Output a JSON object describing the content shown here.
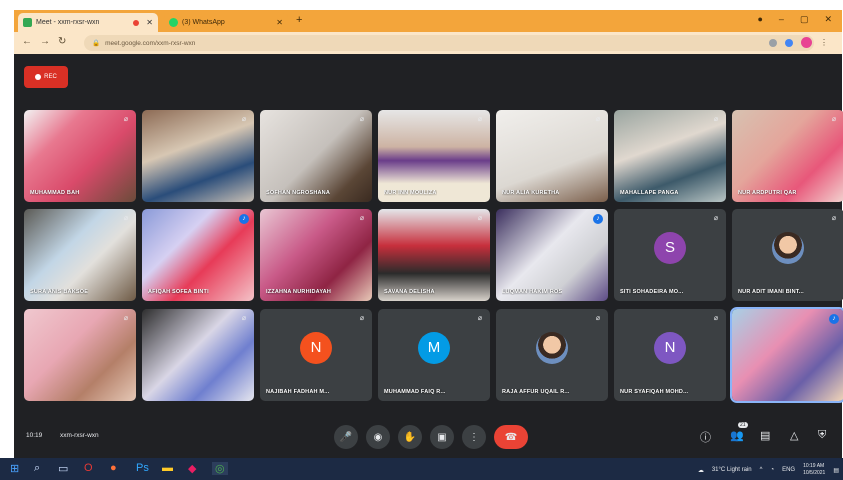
{
  "browser": {
    "tabs": [
      {
        "title": "Meet - xxm-rxsr-wxn",
        "favicon": "meet-icon",
        "active": true
      },
      {
        "title": "(3) WhatsApp",
        "favicon": "whatsapp-icon",
        "active": false
      }
    ],
    "new_tab_label": "+",
    "url": "meet.google.com/xxm-rxsr-wxn",
    "colors": {
      "tabbar": "#f3a53b",
      "toolbar": "#fbe6c8"
    }
  },
  "meet": {
    "record_label": "REC",
    "participants": [
      {
        "name": "MUHAMMAD BAH",
        "type": "video",
        "muted": true
      },
      {
        "name": "",
        "type": "video",
        "muted": true
      },
      {
        "name": "SOFHAN NGROSHANA",
        "type": "video",
        "muted": true
      },
      {
        "name": "NUR INN MOULIZA",
        "type": "video",
        "muted": true
      },
      {
        "name": "NUR ALIA KURETHA",
        "type": "video",
        "muted": true
      },
      {
        "name": "MAHALLAPE PANGA",
        "type": "video",
        "muted": true
      },
      {
        "name": "NUR ARDPUTRI QAR",
        "type": "video",
        "muted": true
      },
      {
        "name": "SURA ANIS BAKSOE",
        "type": "video",
        "muted": true
      },
      {
        "name": "AFIQAH SOFEA BINTI",
        "type": "video",
        "muted": false
      },
      {
        "name": "IZZAHNA NURHIDAYAH",
        "type": "video",
        "muted": true
      },
      {
        "name": "SAVANA DELISHA",
        "type": "video",
        "muted": true
      },
      {
        "name": "LUQMAN HAKIM ROS",
        "type": "video",
        "muted": false
      },
      {
        "name": "SITI SOHADEIRA MO...",
        "type": "avatar",
        "initial": "S",
        "color": "#8e44ad",
        "muted": true
      },
      {
        "name": "NUR ADIT IMANI BINT...",
        "type": "photo",
        "muted": true
      },
      {
        "name": "",
        "type": "video",
        "muted": true
      },
      {
        "name": "",
        "type": "video",
        "muted": true
      },
      {
        "name": "NAJIBAH FADHAH M...",
        "type": "avatar",
        "initial": "N",
        "color": "#f4511e",
        "muted": true
      },
      {
        "name": "MUHAMMAD FAIQ R...",
        "type": "avatar",
        "initial": "M",
        "color": "#039be5",
        "muted": true
      },
      {
        "name": "RAJA AFFUR UQAIL R...",
        "type": "photo",
        "muted": true
      },
      {
        "name": "NUR SYAFIQAH MOHD...",
        "type": "avatar",
        "initial": "N",
        "color": "#7e57c2",
        "muted": true
      },
      {
        "name": "",
        "type": "video",
        "muted": false
      }
    ],
    "time": "10:19",
    "meeting_code": "xxm-rxsr-wxn",
    "controls": [
      "mic-icon",
      "camera-icon",
      "raise-hand-icon",
      "present-icon",
      "more-icon",
      "end-call-icon"
    ],
    "right_controls": [
      "info-icon",
      "people-icon",
      "chat-icon",
      "activities-icon",
      "host-controls-icon"
    ],
    "people_count": "21"
  },
  "taskbar": {
    "weather": "31°C  Light rain",
    "language": "ENG",
    "clock_time": "10:19 AM",
    "clock_date": "10/5/2021"
  }
}
